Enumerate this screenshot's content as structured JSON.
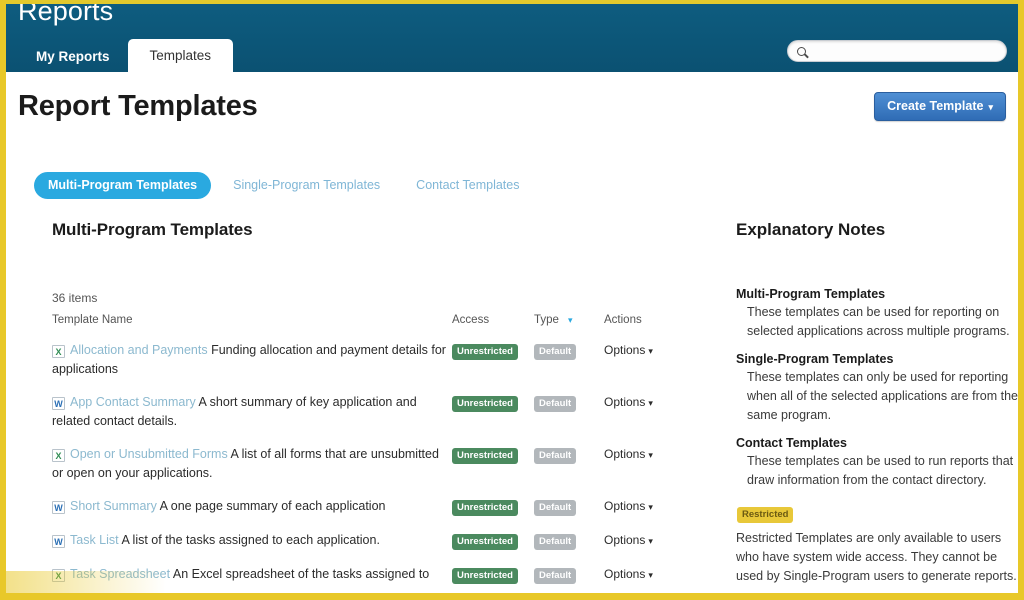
{
  "app": {
    "title": "Reports",
    "tabs": [
      {
        "label": "My Reports",
        "active": false
      },
      {
        "label": "Templates",
        "active": true
      }
    ],
    "search": {
      "value": "",
      "placeholder": "",
      "icon": "search-icon"
    }
  },
  "page": {
    "title": "Report Templates",
    "create_button": {
      "label": "Create Template",
      "caret": "▾"
    },
    "pills": [
      {
        "label": "Multi-Program Templates",
        "active": true
      },
      {
        "label": "Single-Program Templates",
        "active": false
      },
      {
        "label": "Contact Templates",
        "active": false
      }
    ]
  },
  "main": {
    "section_title": "Multi-Program Templates",
    "item_count": "36 items",
    "columns": {
      "name": "Template Name",
      "access": "Access",
      "type": "Type",
      "type_sort_caret": "▾",
      "actions": "Actions"
    },
    "options_label": "Options",
    "options_caret": "▾",
    "rows": [
      {
        "icon": "excel-file-icon",
        "icon_glyph": "X",
        "icon_kind": "xls",
        "name": "Allocation and Payments",
        "description": "Funding allocation and payment details for applications",
        "access": "Unrestricted",
        "type": "Default"
      },
      {
        "icon": "word-file-icon",
        "icon_glyph": "W",
        "icon_kind": "doc",
        "name": "App Contact Summary",
        "description": "A short summary of key application and related contact details.",
        "access": "Unrestricted",
        "type": "Default"
      },
      {
        "icon": "excel-file-icon",
        "icon_glyph": "X",
        "icon_kind": "xls",
        "name": "Open or Unsubmitted Forms",
        "description": "A list of all forms that are unsubmitted or open on your applications.",
        "access": "Unrestricted",
        "type": "Default"
      },
      {
        "icon": "word-file-icon",
        "icon_glyph": "W",
        "icon_kind": "doc",
        "name": "Short Summary",
        "description": "A one page summary of each application",
        "access": "Unrestricted",
        "type": "Default"
      },
      {
        "icon": "word-file-icon",
        "icon_glyph": "W",
        "icon_kind": "doc",
        "name": "Task List",
        "description": "A list of the tasks assigned to each application.",
        "access": "Unrestricted",
        "type": "Default"
      },
      {
        "icon": "excel-file-icon",
        "icon_glyph": "X",
        "icon_kind": "xls",
        "name": "Task Spreadsheet",
        "description": "An Excel spreadsheet of the tasks assigned to",
        "access": "Unrestricted",
        "type": "Default"
      }
    ]
  },
  "notes": {
    "title": "Explanatory Notes",
    "entries": [
      {
        "term": "Multi-Program Templates",
        "definition": "These templates can be used for reporting on selected applications across multiple programs."
      },
      {
        "term": "Single-Program Templates",
        "definition": "These templates can only be used for reporting when all of the selected applications are from the same program."
      },
      {
        "term": "Contact Templates",
        "definition": "These templates can be used to run reports that draw information from the contact directory."
      }
    ],
    "restricted_badge": "Restricted",
    "restricted_text": "Restricted Templates are only available to users who have system wide access. They cannot be used by Single-Program users to generate reports."
  },
  "colors": {
    "header_blue": "#0d5b7d",
    "accent_blue": "#2aa9e0",
    "button_blue": "#2f6cb5",
    "badge_green": "#4b8a5f",
    "badge_gray": "#b2b7bb",
    "badge_gold": "#e8c839",
    "frame_gold": "#e8c829"
  }
}
